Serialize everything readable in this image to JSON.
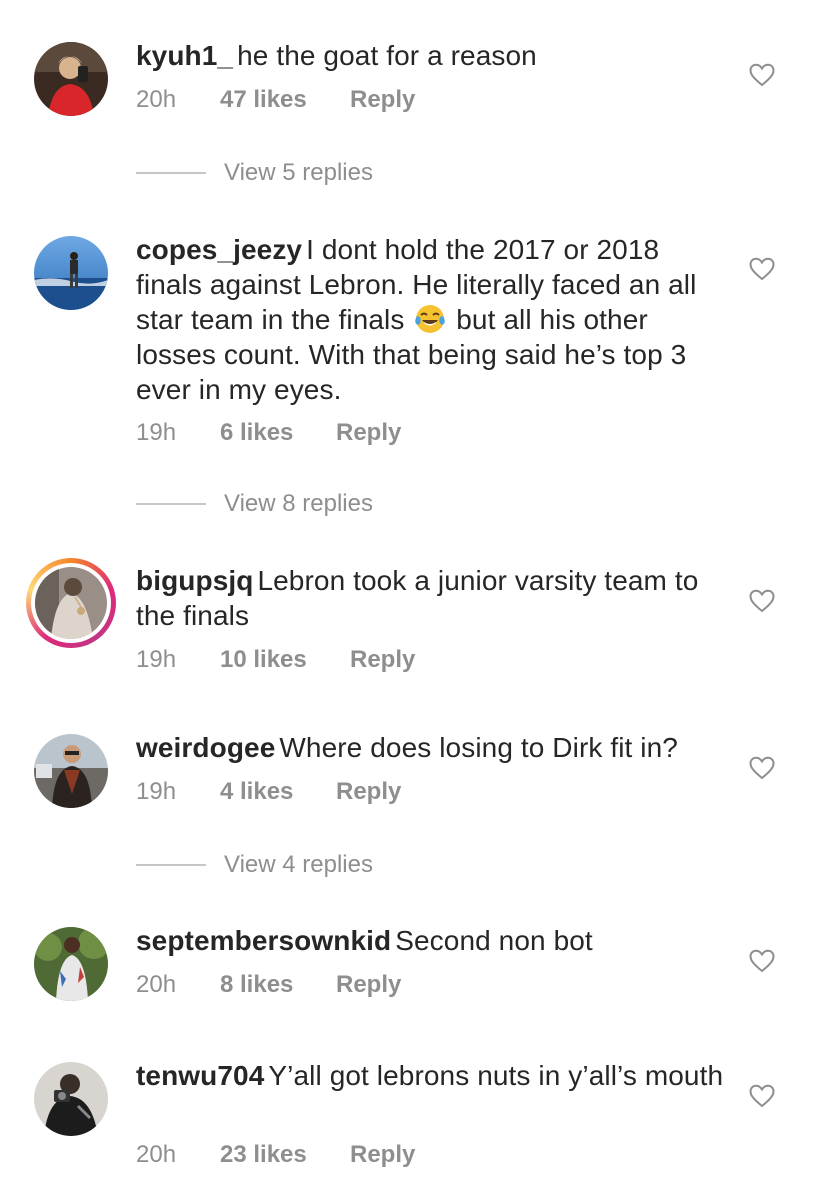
{
  "comments": [
    {
      "username": "kyuh1_",
      "text": "he the goat for a reason",
      "time": "20h",
      "likes": "47 likes",
      "reply": "Reply",
      "avatar_icon": "user-avatar-red-jacket",
      "view_replies": "View 5 replies"
    },
    {
      "username": "copes_jeezy",
      "text_before_emoji": "I dont hold the 2017 or 2018 finals against Lebron. He literally faced an all star team in the finals",
      "emoji_icon": "face-with-tears-of-joy-icon",
      "text_after_emoji": "but all his other losses count. With that being said he’s top 3 ever in my eyes.",
      "time": "19h",
      "likes": "6 likes",
      "reply": "Reply",
      "avatar_icon": "user-avatar-ocean",
      "view_replies": "View 8 replies"
    },
    {
      "username": "bigupsjq",
      "text": "Lebron took a junior varsity team to the finals",
      "time": "19h",
      "likes": "10 likes",
      "reply": "Reply",
      "avatar_icon": "user-avatar-story-ring"
    },
    {
      "username": "weirdogee",
      "text": "Where does losing to Dirk fit in?",
      "time": "19h",
      "likes": "4 likes",
      "reply": "Reply",
      "avatar_icon": "user-avatar-street",
      "view_replies": "View 4 replies"
    },
    {
      "username": "septembersownkid",
      "text": "Second non bot",
      "time": "20h",
      "likes": "8 likes",
      "reply": "Reply",
      "avatar_icon": "user-avatar-jacket"
    },
    {
      "username": "tenwu704",
      "text": "Y’all got lebrons nuts in y’all’s mouth",
      "time": "20h",
      "likes": "23 likes",
      "reply": "Reply",
      "avatar_icon": "user-avatar-dark"
    }
  ],
  "icons": {
    "like": "heart-outline-icon"
  },
  "colors": {
    "text": "#262626",
    "secondary": "#8e8e8e",
    "divider": "#c7c7c7",
    "story_ring": "#dd2a7b"
  }
}
